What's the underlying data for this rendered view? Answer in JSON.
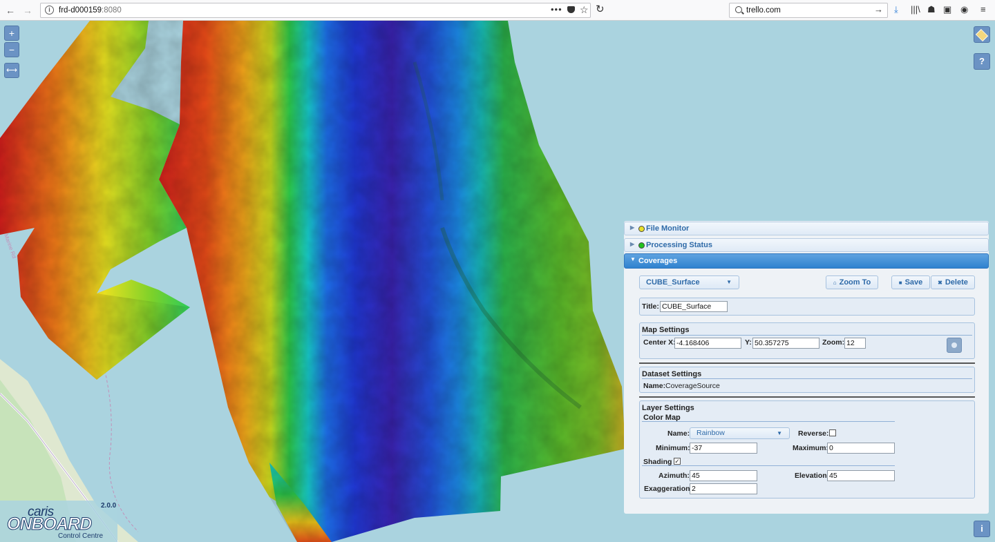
{
  "browser": {
    "url_host": "frd-d000159",
    "url_port": ":8080",
    "search_value": "trello.com",
    "icons": [
      "back-icon",
      "forward-icon",
      "info-icon",
      "more-icon",
      "pocket-icon",
      "bookmark-star-icon",
      "reload-icon",
      "search-icon",
      "go-arrow-icon",
      "download-icon",
      "library-icon",
      "synced-tabs-icon",
      "sidebar-icon",
      "account-icon",
      "menu-icon"
    ]
  },
  "map": {
    "zoom_in": "+",
    "zoom_out": "−",
    "extent": "⟷",
    "help": "?",
    "info": "i",
    "road_label": "Marine Rd"
  },
  "logo": {
    "version": "2.0.0",
    "brand_top": "caris",
    "brand_main": "ONBOARD",
    "brand_sub": "Control Centre"
  },
  "panel": {
    "file_monitor": {
      "label": "File Monitor",
      "status_color": "#e8e02a"
    },
    "processing_status": {
      "label": "Processing Status",
      "status_color": "#22c21e"
    },
    "coverages": {
      "label": "Coverages",
      "selected_coverage": "CUBE_Surface",
      "zoom_to": "Zoom To",
      "save": "Save",
      "delete": "Delete",
      "title_label": "Title:",
      "title_value": "CUBE_Surface",
      "map_settings": {
        "heading": "Map Settings",
        "center_x_label": "Center X:",
        "center_x": "-4.168406",
        "y_label": "Y:",
        "y": "50.357275",
        "zoom_label": "Zoom:",
        "zoom": "12"
      },
      "dataset_settings": {
        "heading": "Dataset Settings",
        "name_label": "Name:",
        "name_value": "CoverageSource"
      },
      "layer_settings": {
        "heading": "Layer Settings",
        "color_map_heading": "Color Map",
        "name_label": "Name:",
        "name_value": "Rainbow",
        "reverse_label": "Reverse:",
        "reverse_checked": false,
        "minimum_label": "Minimum:",
        "minimum": "-37",
        "maximum_label": "Maximum:",
        "maximum": "0",
        "shading_label": "Shading",
        "shading_checked": true,
        "azimuth_label": "Azimuth:",
        "azimuth": "45",
        "elevation_label": "Elevation:",
        "elevation": "45",
        "exaggeration_label": "Exaggeration:",
        "exaggeration": "2"
      }
    }
  }
}
